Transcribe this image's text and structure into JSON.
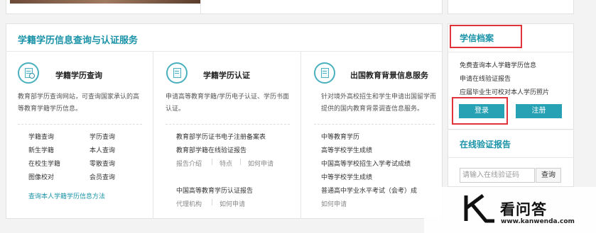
{
  "top": {
    "right_text": ""
  },
  "main": {
    "title": "学籍学历信息查询与认证服务",
    "services": [
      {
        "title": "学籍学历查询",
        "desc": "教育部学历查询网站，可查询国家承认的高等教育学籍学历信息。",
        "links_left": [
          "学籍查询",
          "新生学籍",
          "在校生学籍",
          "图像校对"
        ],
        "links_right": [
          "学历查询",
          "本人查询",
          "零散查询",
          "会员查询"
        ],
        "footer": "查询本人学籍学历信息方法"
      },
      {
        "title": "学籍学历认证",
        "desc": "申请高等教育学籍/学历电子认证、学历书面认证。",
        "items": [
          "教育部学历证书电子注册备案表",
          "教育部学籍在线验证报告"
        ],
        "sublinks1": [
          "报告介绍",
          "特点",
          "如何申请"
        ],
        "item3": "中国高等教育学历认证报告",
        "sublinks2": [
          "代理机构",
          "如何申请"
        ]
      },
      {
        "title": "出国教育背景信息服务",
        "desc": "针对境外高校招生和学生申请出国留学而提供的国内教育背景调查信息服务。",
        "items": [
          "中等教育学历",
          "高等学校学生成绩",
          "中国高等学校招生入学考试成绩",
          "中等学校学生成绩",
          "普通高中学业水平考试（会考）成"
        ],
        "footer": "如何申请"
      }
    ]
  },
  "side": {
    "archive_title": "学信档案",
    "archive_links": [
      "免费查询本人学籍学历信息",
      "申请在线验证报告",
      "应届毕业生可校对本人学历照片"
    ],
    "login_label": "登录",
    "register_label": "注册",
    "verify_title": "在线验证报告",
    "verify_placeholder": "请输入在线验证码",
    "query_label": "查询"
  },
  "watermark": {
    "name": "看问答",
    "url": "www.kanwenda.com"
  }
}
